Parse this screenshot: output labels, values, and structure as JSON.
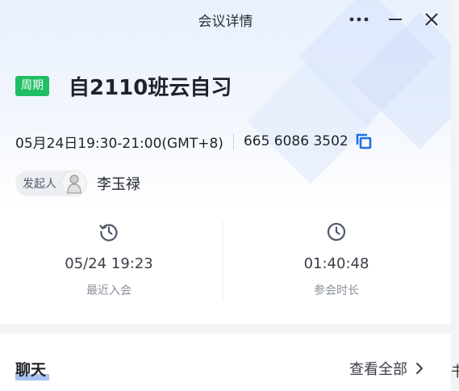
{
  "window": {
    "title": "会议详情"
  },
  "meeting": {
    "tag": "周期",
    "title": "自2110班云自习",
    "datetime": "05月24日19:30-21:00(GMT+8)",
    "meeting_id": "665 6086 3502"
  },
  "host": {
    "label": "发起人",
    "name": "李玉禄"
  },
  "stats": {
    "join": {
      "value": "05/24 19:23",
      "label": "最近入会"
    },
    "duration": {
      "value": "01:40:48",
      "label": "参会时长"
    }
  },
  "chat": {
    "label": "聊天",
    "view_all": "查看全部"
  },
  "edge_fragment": "书",
  "colors": {
    "accent": "#1f6fe5",
    "tag_green": "#1fbe64"
  }
}
